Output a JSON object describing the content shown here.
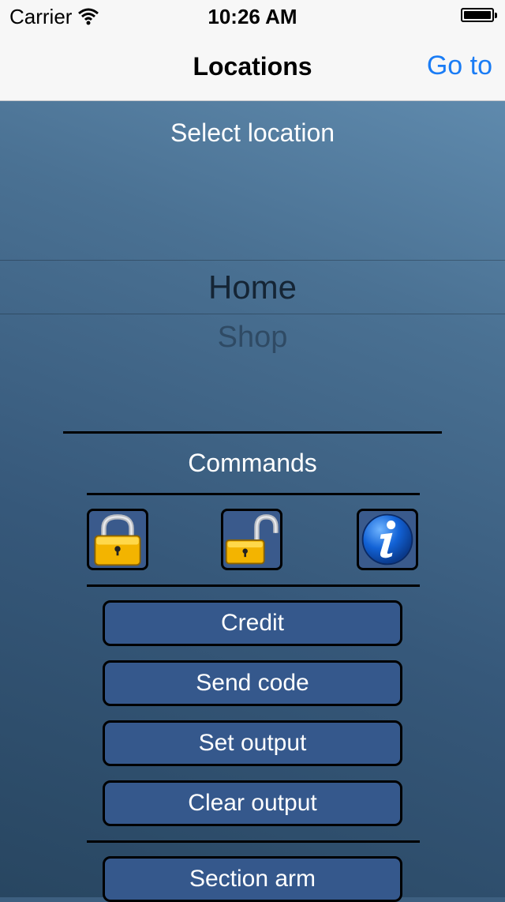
{
  "status_bar": {
    "carrier": "Carrier",
    "time": "10:26 AM"
  },
  "nav": {
    "title": "Locations",
    "go_to": "Go to"
  },
  "picker": {
    "title": "Select location",
    "items": [
      {
        "label": "Home",
        "selected": true
      },
      {
        "label": "Shop",
        "selected": false
      }
    ]
  },
  "commands": {
    "title": "Commands",
    "icons": [
      "padlock-locked-icon",
      "padlock-unlocked-icon",
      "info-icon"
    ],
    "buttons": [
      "Credit",
      "Send code",
      "Set output",
      "Clear output",
      "Section arm"
    ]
  },
  "colors": {
    "accent": "#1a7cf5",
    "button_fill": "#35588c",
    "background_dark": "#284661",
    "background_light": "#5f8aad"
  }
}
